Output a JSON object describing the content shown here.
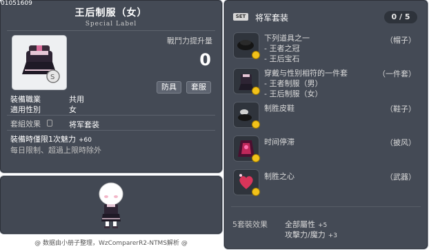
{
  "item": {
    "id": "01051609",
    "name": "王后制服（女）",
    "label": "Special Label",
    "power_label": "戰鬥力提升量",
    "power_value": "0",
    "tags": [
      "防具",
      "套服"
    ],
    "job_label": "裝備職業",
    "job_value": "共用",
    "gender_label": "適用性別",
    "gender_value": "女",
    "set_label": "套組效果",
    "set_value": "将军套装",
    "charm_text": "裝備時僅限1次魅力",
    "charm_value": "+60",
    "limit_text": "每日限制、超過上限時除外"
  },
  "footer": "@ 数据由小册子整理，WzComparerR2-NTMS解析 @",
  "set": {
    "badge": "SET",
    "title": "将军套装",
    "count": "0 / 5",
    "parts": [
      {
        "lines": [
          "下列道具之一",
          "- 王者之冠",
          "- 王后宝石"
        ],
        "type": "（帽子）"
      },
      {
        "lines": [
          "穿戴与性别相符的一件套",
          "- 王者制服（男）",
          "- 王后制服（女）"
        ],
        "type": "（一件套）"
      },
      {
        "lines": [
          "制胜皮鞋"
        ],
        "type": "（鞋子）"
      },
      {
        "lines": [
          "时间停滞"
        ],
        "type": "（披风）"
      },
      {
        "lines": [
          "制胜之心"
        ],
        "type": "（武器）"
      }
    ],
    "bonus_title": "5套裝效果",
    "bonus_1_label": "全部屬性",
    "bonus_1_value": "+5",
    "bonus_2_label": "攻擊力/魔力",
    "bonus_2_value": "+3"
  },
  "colors": {
    "panel": "#444a55",
    "accent": "#ffffff",
    "coin": "#f2c21a"
  },
  "icons": [
    "uniform-icon",
    "crown-icon",
    "shoes-icon",
    "cape-icon",
    "heart-weapon-icon",
    "coin-icon",
    "lock-icon"
  ]
}
